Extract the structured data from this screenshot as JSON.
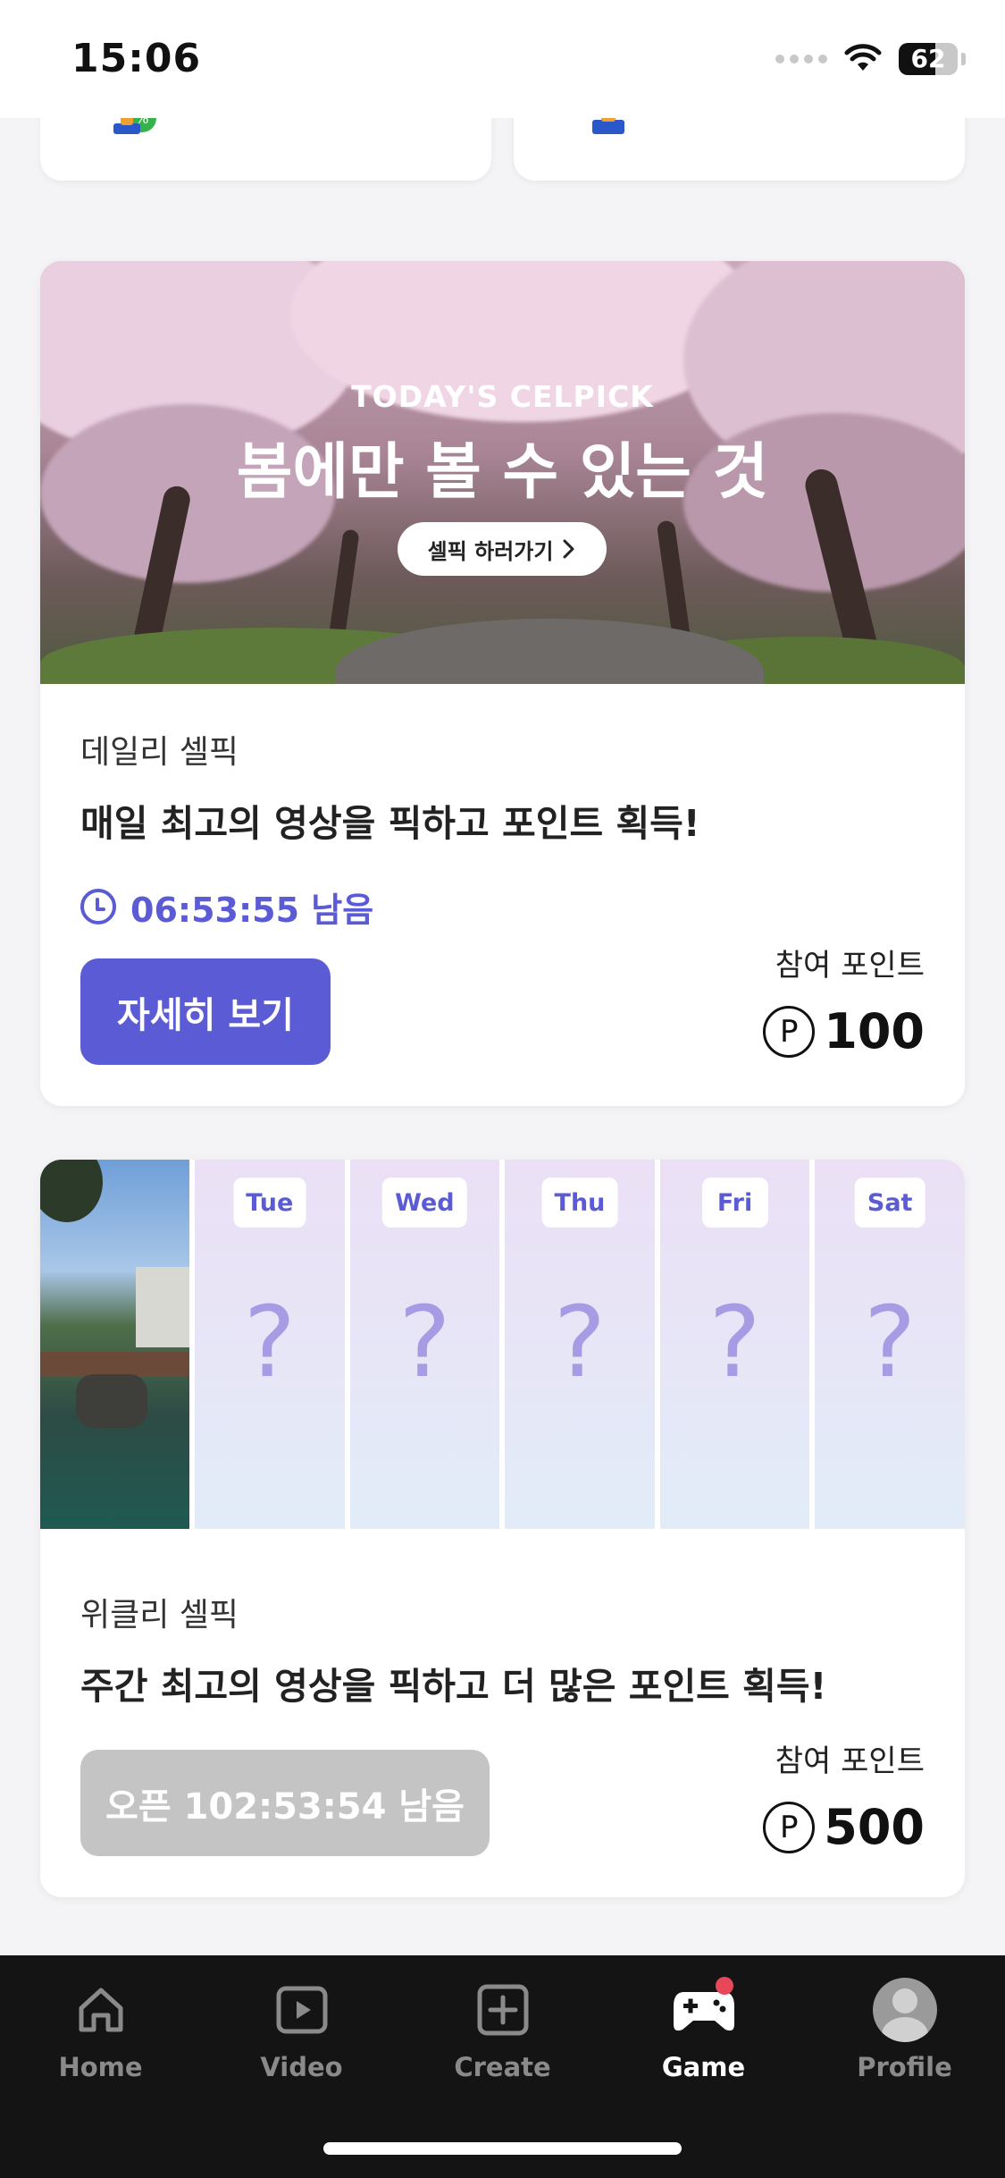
{
  "status_bar": {
    "time": "15:06",
    "battery_level": "62"
  },
  "daily": {
    "banner_subtitle": "TODAY'S CELPICK",
    "banner_title": "봄에만 볼 수 있는 것",
    "banner_button": "셀픽 하러가기",
    "label": "데일리 셀픽",
    "headline": "매일 최고의 영상을 픽하고 포인트 획득!",
    "timer": "06:53:55 남음",
    "button": "자세히 보기",
    "points_label": "참여 포인트",
    "points_symbol": "P",
    "points_value": "100"
  },
  "weekly": {
    "days": [
      {
        "label": "Tue",
        "mark": "?"
      },
      {
        "label": "Wed",
        "mark": "?"
      },
      {
        "label": "Thu",
        "mark": "?"
      },
      {
        "label": "Fri",
        "mark": "?"
      },
      {
        "label": "Sat",
        "mark": "?"
      }
    ],
    "label": "위클리 셀픽",
    "headline": "주간 최고의 영상을 픽하고 더 많은 포인트 획득!",
    "button": "오픈 102:53:54 남음",
    "points_label": "참여 포인트",
    "points_symbol": "P",
    "points_value": "500"
  },
  "tab_bar": {
    "tabs": [
      {
        "label": "Home",
        "icon": "home-icon"
      },
      {
        "label": "Video",
        "icon": "play-icon"
      },
      {
        "label": "Create",
        "icon": "plus-square-icon"
      },
      {
        "label": "Game",
        "icon": "gamepad-icon",
        "active": true
      },
      {
        "label": "Profile",
        "icon": "avatar"
      }
    ]
  },
  "colors": {
    "accent": "#5b5bd6",
    "disabled": "#c4c4c4",
    "tab_bar_bg": "#141414",
    "notification": "#e8475a"
  }
}
